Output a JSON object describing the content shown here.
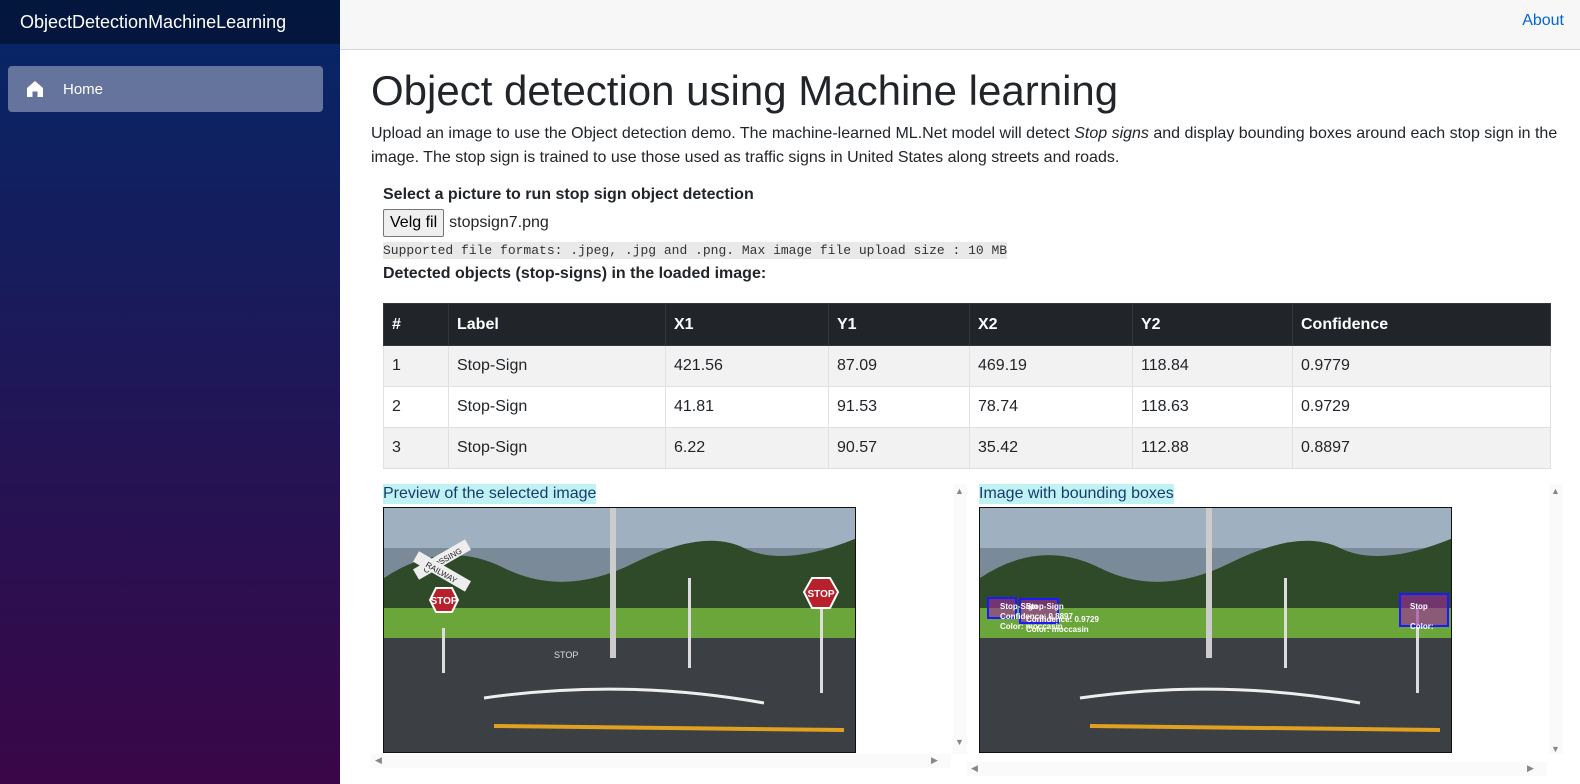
{
  "app": {
    "brand": "ObjectDetectionMachineLearning"
  },
  "sidebar": {
    "items": [
      {
        "label": "Home"
      }
    ]
  },
  "topbar": {
    "about": "About"
  },
  "main": {
    "title": "Object detection using Machine learning",
    "intro_part1": "Upload an image to use the Object detection demo. The machine-learned ML.Net model will detect ",
    "intro_em": "Stop signs",
    "intro_part2": " and display bounding boxes around each stop sign in the image. The stop sign is trained to use those used as traffic signs in United States along streets and roads.",
    "select_title": "Select a picture to run stop sign object detection",
    "file_button": "Velg fil",
    "file_name": "stopsign7.png",
    "formats_note": "Supported file formats: .jpeg, .jpg and .png. Max image file upload size : 10 MB",
    "detected_title": "Detected objects (stop-signs) in the loaded image:"
  },
  "table": {
    "headers": [
      "#",
      "Label",
      "X1",
      "Y1",
      "X2",
      "Y2",
      "Confidence"
    ],
    "rows": [
      [
        "1",
        "Stop-Sign",
        "421.56",
        "87.09",
        "469.19",
        "118.84",
        "0.9779"
      ],
      [
        "2",
        "Stop-Sign",
        "41.81",
        "91.53",
        "78.74",
        "118.63",
        "0.9729"
      ],
      [
        "3",
        "Stop-Sign",
        "6.22",
        "90.57",
        "35.42",
        "112.88",
        "0.8897"
      ]
    ]
  },
  "preview": {
    "title": "Preview of the selected image",
    "sign_text": "STOP",
    "crossing_text": "CROSSING",
    "railway_text": "RAILWAY",
    "road_text": "STOP"
  },
  "result": {
    "title": "Image with bounding boxes",
    "box_label_a": "Stop-Sign",
    "box_label_b": "Stop-Sign",
    "box_label_c": "Stop",
    "conf_a": "Confidence: 0.8897",
    "conf_b": "Confidence: 0.9729",
    "color_a": "Color: moccasin",
    "color_b": "Color: moccasin",
    "color_c": "Color:"
  }
}
